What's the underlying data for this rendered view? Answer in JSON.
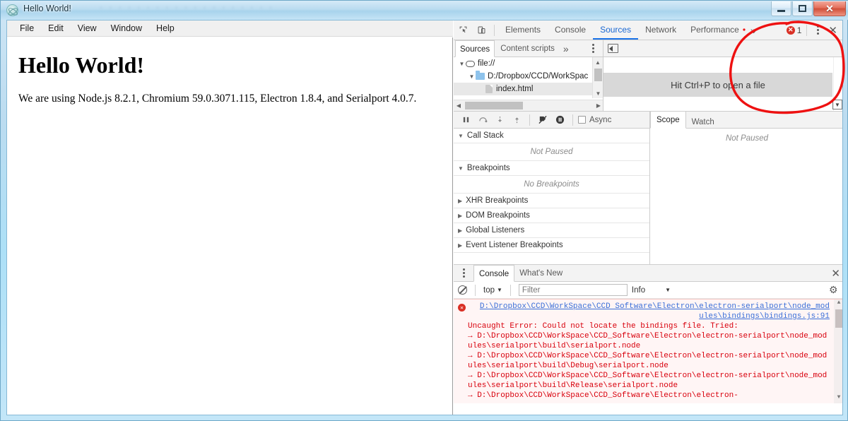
{
  "window": {
    "title": "Hello World!",
    "ghost_text": "· · · · · · · ·   · · ·      · · · · · · · ·",
    "icon": "electron-atom-icon",
    "controls": {
      "minimize": "–",
      "maximize": "□",
      "close": "✕"
    }
  },
  "menubar": {
    "items": [
      {
        "label": "File"
      },
      {
        "label": "Edit"
      },
      {
        "label": "View"
      },
      {
        "label": "Window"
      },
      {
        "label": "Help"
      }
    ]
  },
  "page": {
    "heading": "Hello World!",
    "paragraph": "We are using Node.js 8.2.1, Chromium 59.0.3071.115, Electron 1.8.4, and Serialport 4.0.7."
  },
  "devtools": {
    "inspect_icon": "inspect-element-icon",
    "device_icon": "toggle-device-toolbar-icon",
    "tabs": [
      {
        "label": "Elements",
        "active": false
      },
      {
        "label": "Console",
        "active": false
      },
      {
        "label": "Sources",
        "active": true
      },
      {
        "label": "Network",
        "active": false
      },
      {
        "label": "Performance",
        "active": false
      }
    ],
    "more_tabs": "»",
    "error_count": "1",
    "error_icon": "error-circle-icon",
    "menu_icon": "kebab-menu-icon",
    "close_icon": "close-icon",
    "sources": {
      "subtabs": [
        {
          "label": "Sources",
          "active": true
        },
        {
          "label": "Content scripts",
          "active": false
        }
      ],
      "subtabs_more": "»",
      "subtabs_menu": "kebab-menu-icon",
      "collapse_icon": "show-navigator-icon",
      "tree": [
        {
          "label": "file://",
          "icon": "frame-icon",
          "depth": 0,
          "twisty": "▼",
          "selected": false
        },
        {
          "label": "D:/Dropbox/CCD/WorkSpac",
          "icon": "folder-icon",
          "depth": 1,
          "twisty": "▼",
          "selected": false
        },
        {
          "label": "index.html",
          "icon": "file-icon",
          "depth": 2,
          "twisty": "",
          "selected": true
        }
      ],
      "editor_placeholder": "Hit Ctrl+P to open a file"
    },
    "debugger": {
      "buttons": [
        {
          "name": "pause-resume-button",
          "glyph": "❚❚"
        },
        {
          "name": "step-over-button",
          "glyph": "⤻"
        },
        {
          "name": "step-into-button",
          "glyph": "↓"
        },
        {
          "name": "step-out-button",
          "glyph": "↑"
        },
        {
          "name": "deactivate-breakpoints-button",
          "glyph": "⃫"
        },
        {
          "name": "pause-on-exceptions-button",
          "glyph": "◍"
        }
      ],
      "async_label": "Async",
      "async_checked": false,
      "side_tabs": [
        {
          "label": "Scope",
          "active": true
        },
        {
          "label": "Watch",
          "active": false
        }
      ],
      "side_empty": "Not Paused",
      "sections": [
        {
          "label": "Call Stack",
          "expanded": true,
          "twisty": "▼",
          "empty": "Not Paused"
        },
        {
          "label": "Breakpoints",
          "expanded": true,
          "twisty": "▼",
          "empty": "No Breakpoints"
        },
        {
          "label": "XHR Breakpoints",
          "expanded": false,
          "twisty": "▶",
          "empty": ""
        },
        {
          "label": "DOM Breakpoints",
          "expanded": false,
          "twisty": "▶",
          "empty": ""
        },
        {
          "label": "Global Listeners",
          "expanded": false,
          "twisty": "▶",
          "empty": ""
        },
        {
          "label": "Event Listener Breakpoints",
          "expanded": false,
          "twisty": "▶",
          "empty": ""
        }
      ]
    },
    "drawer": {
      "menu_icon": "kebab-menu-icon",
      "tabs": [
        {
          "label": "Console",
          "active": true
        },
        {
          "label": "What's New",
          "active": false
        }
      ],
      "close_icon": "close-icon",
      "clear_icon": "clear-console-icon",
      "context": "top",
      "context_caret": "▼",
      "filter_placeholder": "Filter",
      "level": "Info",
      "level_caret": "▼",
      "settings_icon": "gear-icon",
      "messages": [
        {
          "type": "error",
          "link": "D:\\Dropbox\\CCD\\WorkSpace\\CCD Software\\Electron\\electron-serialport\\node_modules\\bindings\\bindings.js:91",
          "text": "Uncaught Error: Could not locate the bindings file. Tried:",
          "paths": [
            "→ D:\\Dropbox\\CCD\\WorkSpace\\CCD_Software\\Electron\\electron-serialport\\node_modules\\serialport\\build\\serialport.node",
            "→ D:\\Dropbox\\CCD\\WorkSpace\\CCD_Software\\Electron\\electron-serialport\\node_modules\\serialport\\build\\Debug\\serialport.node",
            "→ D:\\Dropbox\\CCD\\WorkSpace\\CCD_Software\\Electron\\electron-serialport\\node_modules\\serialport\\build\\Release\\serialport.node",
            "→ D:\\Dropbox\\CCD\\WorkSpace\\CCD_Software\\Electron\\electron-"
          ]
        }
      ]
    }
  },
  "annotation": {
    "shape": "red-hand-drawn-circle",
    "color": "#ee1111"
  }
}
